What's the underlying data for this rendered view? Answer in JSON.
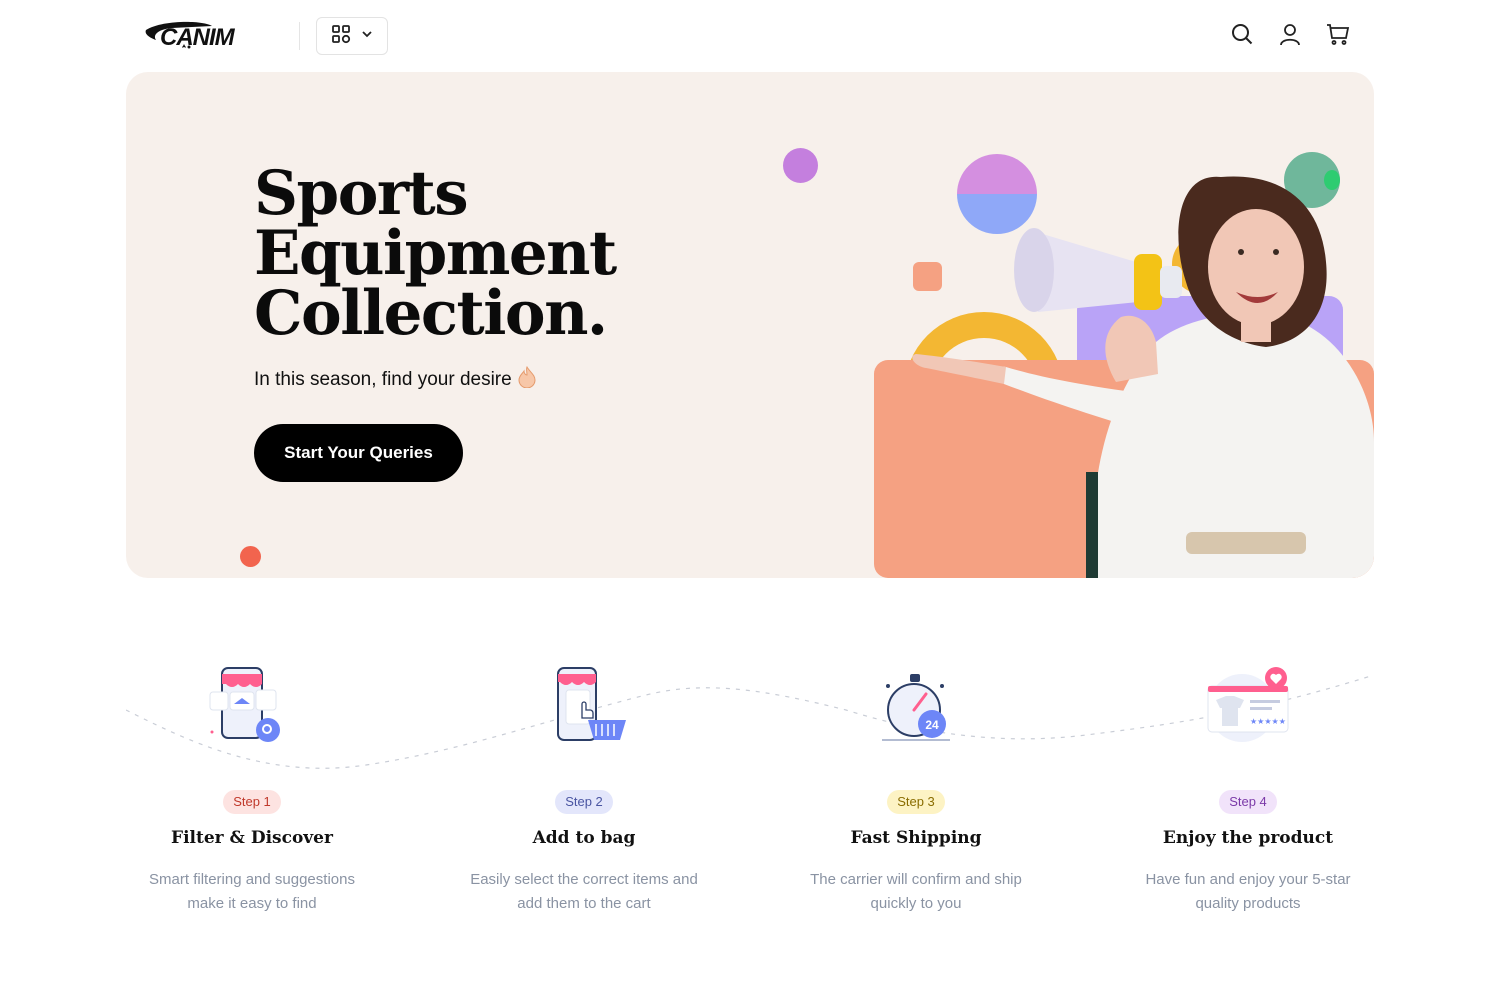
{
  "header": {
    "logo_text": "CANIM",
    "icons": {
      "categories": "grid-icon",
      "dropdown": "chevron-down-icon",
      "search": "search-icon",
      "account": "user-icon",
      "cart": "cart-icon"
    }
  },
  "hero": {
    "title_line1": "Sports",
    "title_line2": "Equipment",
    "title_line3": "Collection.",
    "subtitle": "In this season, find your desire",
    "subtitle_icon": "flame-icon",
    "cta_label": "Start Your Queries"
  },
  "steps": [
    {
      "badge": "Step 1",
      "title": "Filter & Discover",
      "desc": "Smart filtering and suggestions make it easy to find",
      "icon": "shop-search-icon",
      "badge_bg": "#fde3e1",
      "badge_fg": "#c0392b"
    },
    {
      "badge": "Step 2",
      "title": "Add to bag",
      "desc": "Easily select the correct items and add them to the cart",
      "icon": "phone-basket-icon",
      "badge_bg": "#e3e6fb",
      "badge_fg": "#4a55a2"
    },
    {
      "badge": "Step 3",
      "title": "Fast Shipping",
      "desc": "The carrier will confirm and ship quickly to you",
      "icon": "stopwatch-icon",
      "badge_bg": "#fdf3c4",
      "badge_fg": "#8a6d00"
    },
    {
      "badge": "Step 4",
      "title": "Enjoy the product",
      "desc": "Have fun and enjoy your 5-star quality products",
      "icon": "product-review-icon",
      "badge_bg": "#f1e3fa",
      "badge_fg": "#7b3aa8"
    }
  ],
  "colors": {
    "hero_bg": "#f7f0eb",
    "cta_bg": "#000000",
    "accent_orange": "#f5a182",
    "accent_yellow": "#f3b733",
    "accent_purple": "#c47fde",
    "accent_lilac": "#b9a3f7"
  }
}
